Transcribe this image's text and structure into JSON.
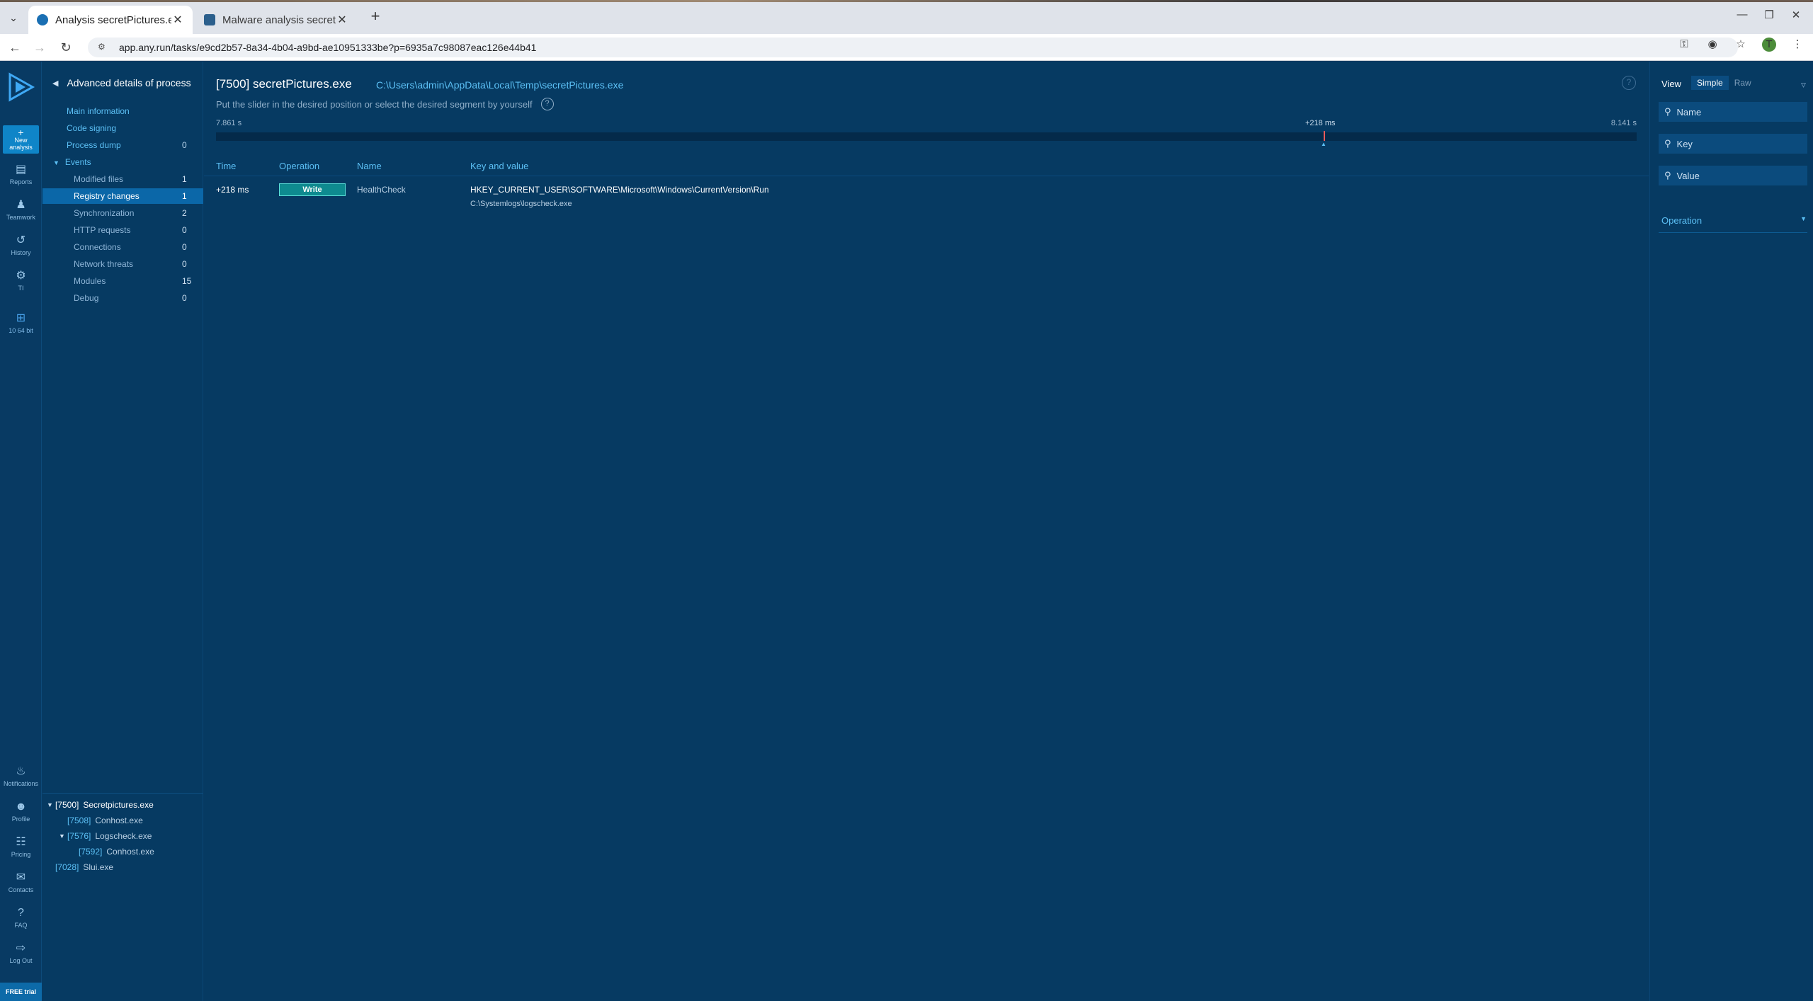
{
  "browser": {
    "tabs": [
      {
        "title": "Analysis secretPictures.exe",
        "active": true
      },
      {
        "title": "Malware analysis secretPictures",
        "active": false
      }
    ],
    "url": "app.any.run/tasks/e9cd2b57-8a34-4b04-a9bd-ae10951333be?p=6935a7c98087eac126e44b41",
    "avatar_letter": "T"
  },
  "rail": {
    "new_analysis": "New analysis",
    "items": [
      {
        "label": "Reports",
        "icon": "reports-icon"
      },
      {
        "label": "Teamwork",
        "icon": "teamwork-icon"
      },
      {
        "label": "History",
        "icon": "history-icon"
      },
      {
        "label": "TI",
        "icon": "ti-gear-icon"
      },
      {
        "label": "10 64 bit",
        "icon": "windows-icon"
      },
      {
        "label": "Notifications",
        "icon": "bell-icon"
      },
      {
        "label": "Profile",
        "icon": "profile-icon"
      },
      {
        "label": "Pricing",
        "icon": "cart-icon"
      },
      {
        "label": "Contacts",
        "icon": "mail-icon"
      },
      {
        "label": "FAQ",
        "icon": "question-icon"
      },
      {
        "label": "Log Out",
        "icon": "logout-icon"
      }
    ],
    "free_trial": "FREE trial"
  },
  "sidebar": {
    "title": "Advanced details of process",
    "top_items": [
      {
        "label": "Main information",
        "count": ""
      },
      {
        "label": "Code signing",
        "count": ""
      },
      {
        "label": "Process dump",
        "count": "0"
      }
    ],
    "events_label": "Events",
    "events": [
      {
        "label": "Modified files",
        "count": "1"
      },
      {
        "label": "Registry changes",
        "count": "1",
        "selected": true
      },
      {
        "label": "Synchronization",
        "count": "2"
      },
      {
        "label": "HTTP requests",
        "count": "0"
      },
      {
        "label": "Connections",
        "count": "0"
      },
      {
        "label": "Network threats",
        "count": "0"
      },
      {
        "label": "Modules",
        "count": "15"
      },
      {
        "label": "Debug",
        "count": "0"
      }
    ],
    "process_tree": [
      {
        "pid": "[7500]",
        "name": "Secretpictures.exe"
      },
      {
        "pid": "[7508]",
        "name": "Conhost.exe"
      },
      {
        "pid": "[7576]",
        "name": "Logscheck.exe"
      },
      {
        "pid": "[7592]",
        "name": "Conhost.exe"
      },
      {
        "pid": "[7028]",
        "name": "Slui.exe"
      }
    ]
  },
  "main": {
    "process_title": "[7500] secretPictures.exe",
    "process_path": "C:\\Users\\admin\\AppData\\Local\\Temp\\secretPictures.exe",
    "hint": "Put the slider in the desired position or select the desired segment by yourself",
    "timeline": {
      "start": "7.861 s",
      "marker": "+218 ms",
      "end": "8.141 s"
    },
    "columns": [
      "Time",
      "Operation",
      "Name",
      "Key and value"
    ],
    "rows": [
      {
        "time": "+218 ms",
        "operation": "Write",
        "name": "HealthCheck",
        "key": "HKEY_CURRENT_USER\\SOFTWARE\\Microsoft\\Windows\\CurrentVersion\\Run",
        "value": "C:\\Systemlogs\\logscheck.exe"
      }
    ]
  },
  "filters": {
    "view_label": "View",
    "simple": "Simple",
    "raw": "Raw",
    "name_placeholder": "Name",
    "key_placeholder": "Key",
    "value_placeholder": "Value",
    "operation_label": "Operation"
  },
  "colors": {
    "background": "#063a62",
    "accent": "#5cc0f5",
    "selected": "#0b67a8",
    "write_badge": "#0e8a8f"
  }
}
